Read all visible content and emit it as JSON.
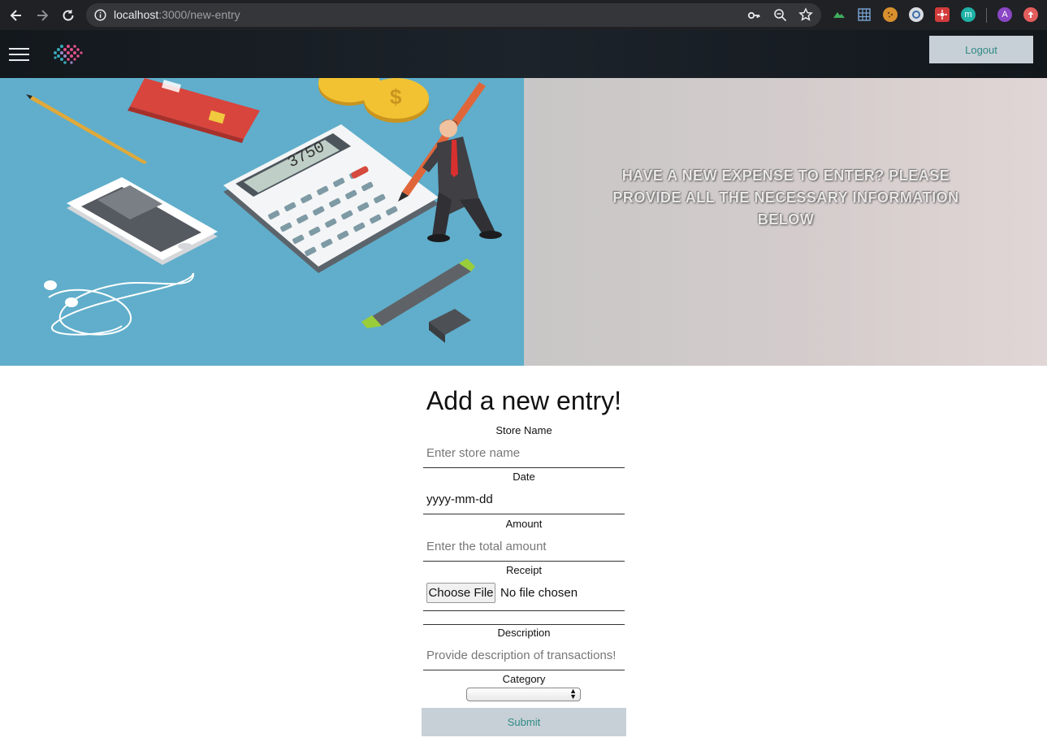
{
  "browser": {
    "url_host": "localhost",
    "url_path": ":3000/new-entry",
    "profile_initial": "A",
    "ext_m_label": "m"
  },
  "header": {
    "logout_label": "Logout"
  },
  "hero": {
    "text": "HAVE A NEW EXPENSE TO ENTER? PLEASE PROVIDE ALL THE NECESSARY INFORMATION BELOW",
    "calculator_display": "3750"
  },
  "form": {
    "title": "Add a new entry!",
    "store_label": "Store Name",
    "store_placeholder": "Enter store name",
    "date_label": "Date",
    "date_value": "yyyy-mm-dd",
    "amount_label": "Amount",
    "amount_placeholder": "Enter the total amount",
    "receipt_label": "Receipt",
    "file_button": "Choose File",
    "file_status": "No file chosen",
    "description_label": "Description",
    "description_placeholder": "Provide description of transactions!",
    "category_label": "Category",
    "category_value": "",
    "submit_label": "Submit"
  },
  "colors": {
    "accent_text": "#2f8a86",
    "button_bg": "#c8d0d7",
    "hero_blue": "#60aecb"
  }
}
